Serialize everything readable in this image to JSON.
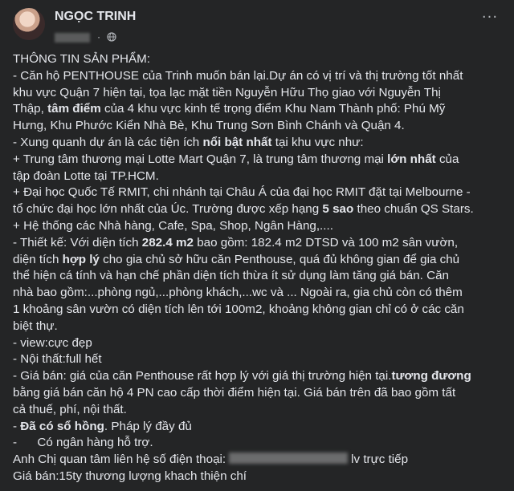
{
  "post": {
    "author": "NGỌC TRINH",
    "more_label": "···",
    "lines": [
      {
        "parts": [
          {
            "t": "THÔNG TIN SẢN PHẨM:"
          }
        ]
      },
      {
        "parts": [
          {
            "t": "- Căn hộ PENTHOUSE của Trinh muốn bán lại.Dự án có vị trí và thị trường tốt nhất"
          }
        ]
      },
      {
        "parts": [
          {
            "t": "khu vực Quận 7 hiện tại, tọa lạc mặt tiền Nguyễn Hữu Thọ giao với Nguyễn Thị"
          }
        ]
      },
      {
        "parts": [
          {
            "t": "Thập, "
          },
          {
            "t": "tâm điểm",
            "b": true
          },
          {
            "t": " của 4 khu vực kinh tế trọng điểm Khu Nam Thành phố: Phú Mỹ"
          }
        ]
      },
      {
        "parts": [
          {
            "t": "Hưng, Khu Phước Kiển Nhà Bè, Khu Trung Sơn Bình Chánh và Quận 4."
          }
        ]
      },
      {
        "parts": [
          {
            "t": "- Xung quanh dự án là các tiện ích "
          },
          {
            "t": "nổi bật nhất",
            "b": true
          },
          {
            "t": " tại khu vực như:"
          }
        ]
      },
      {
        "parts": [
          {
            "t": "+ Trung tâm thương mại Lotte Mart Quận 7, là trung tâm thương mại "
          },
          {
            "t": "lớn nhất",
            "b": true
          },
          {
            "t": " của"
          }
        ]
      },
      {
        "parts": [
          {
            "t": "tập đoàn Lotte tại TP.HCM."
          }
        ]
      },
      {
        "parts": [
          {
            "t": "+ Đại học Quốc Tế RMIT, chi nhánh tại Châu Á của đại học RMIT đặt tại Melbourne -"
          }
        ]
      },
      {
        "parts": [
          {
            "t": "tổ chức đại học lớn nhất của Úc. Trường được xếp hạng "
          },
          {
            "t": "5 sao",
            "b": true
          },
          {
            "t": " theo chuẩn QS Stars."
          }
        ]
      },
      {
        "parts": [
          {
            "t": "+ Hệ thống các Nhà hàng, Cafe, Spa, Shop, Ngân Hàng,...."
          }
        ]
      },
      {
        "parts": [
          {
            "t": "- Thiết kế: Với diện tích "
          },
          {
            "t": "282.4 m2",
            "b": true
          },
          {
            "t": " bao gồm: 182.4 m2 DTSD và 100 m2 sân vườn,"
          }
        ]
      },
      {
        "parts": [
          {
            "t": "diện tích "
          },
          {
            "t": "hợp lý",
            "b": true
          },
          {
            "t": " cho gia chủ sở hữu căn Penthouse, quá đủ không gian để gia chủ"
          }
        ]
      },
      {
        "parts": [
          {
            "t": "thể hiện cá tính và hạn chế phần diện tích thừa ít sử dụng làm tăng giá bán. Căn"
          }
        ]
      },
      {
        "parts": [
          {
            "t": "nhà bao gồm:...phòng ngủ,...phòng khách,...wc và ... Ngoài ra, gia chủ còn có thêm"
          }
        ]
      },
      {
        "parts": [
          {
            "t": "1 khoảng sân vườn có diện tích lên tới 100m2, khoảng không gian chỉ có ở các căn"
          }
        ]
      },
      {
        "parts": [
          {
            "t": "biệt thự."
          }
        ]
      },
      {
        "parts": [
          {
            "t": "- view:cực đẹp"
          }
        ]
      },
      {
        "parts": [
          {
            "t": "- Nội thất:full hết"
          }
        ]
      },
      {
        "parts": [
          {
            "t": "- Giá bán: giá của căn Penthouse rất hợp lý với giá thị trường hiện tại."
          },
          {
            "t": "tương đương",
            "b": true
          }
        ]
      },
      {
        "parts": [
          {
            "t": "bằng giá bán căn hộ 4 PN cao cấp thời điểm hiện tại. Giá bán trên đã bao gồm tất"
          }
        ]
      },
      {
        "parts": [
          {
            "t": "cả thuế, phí, nội thất."
          }
        ]
      },
      {
        "parts": [
          {
            "t": "- "
          },
          {
            "t": "Đã có sổ hồng",
            "b": true
          },
          {
            "t": ". Pháp lý đầy đủ"
          }
        ]
      },
      {
        "parts": [
          {
            "t": "-      Có ngân hàng hỗ trợ."
          }
        ]
      },
      {
        "parts": [
          {
            "t": "Anh Chị quan tâm liên hệ số điện thoại:"
          },
          {
            "blur": true
          },
          {
            "t": "lv trực tiếp"
          }
        ]
      },
      {
        "parts": [
          {
            "t": "Giá bán:15ty thương lượng khach thiện chí"
          }
        ]
      }
    ]
  }
}
